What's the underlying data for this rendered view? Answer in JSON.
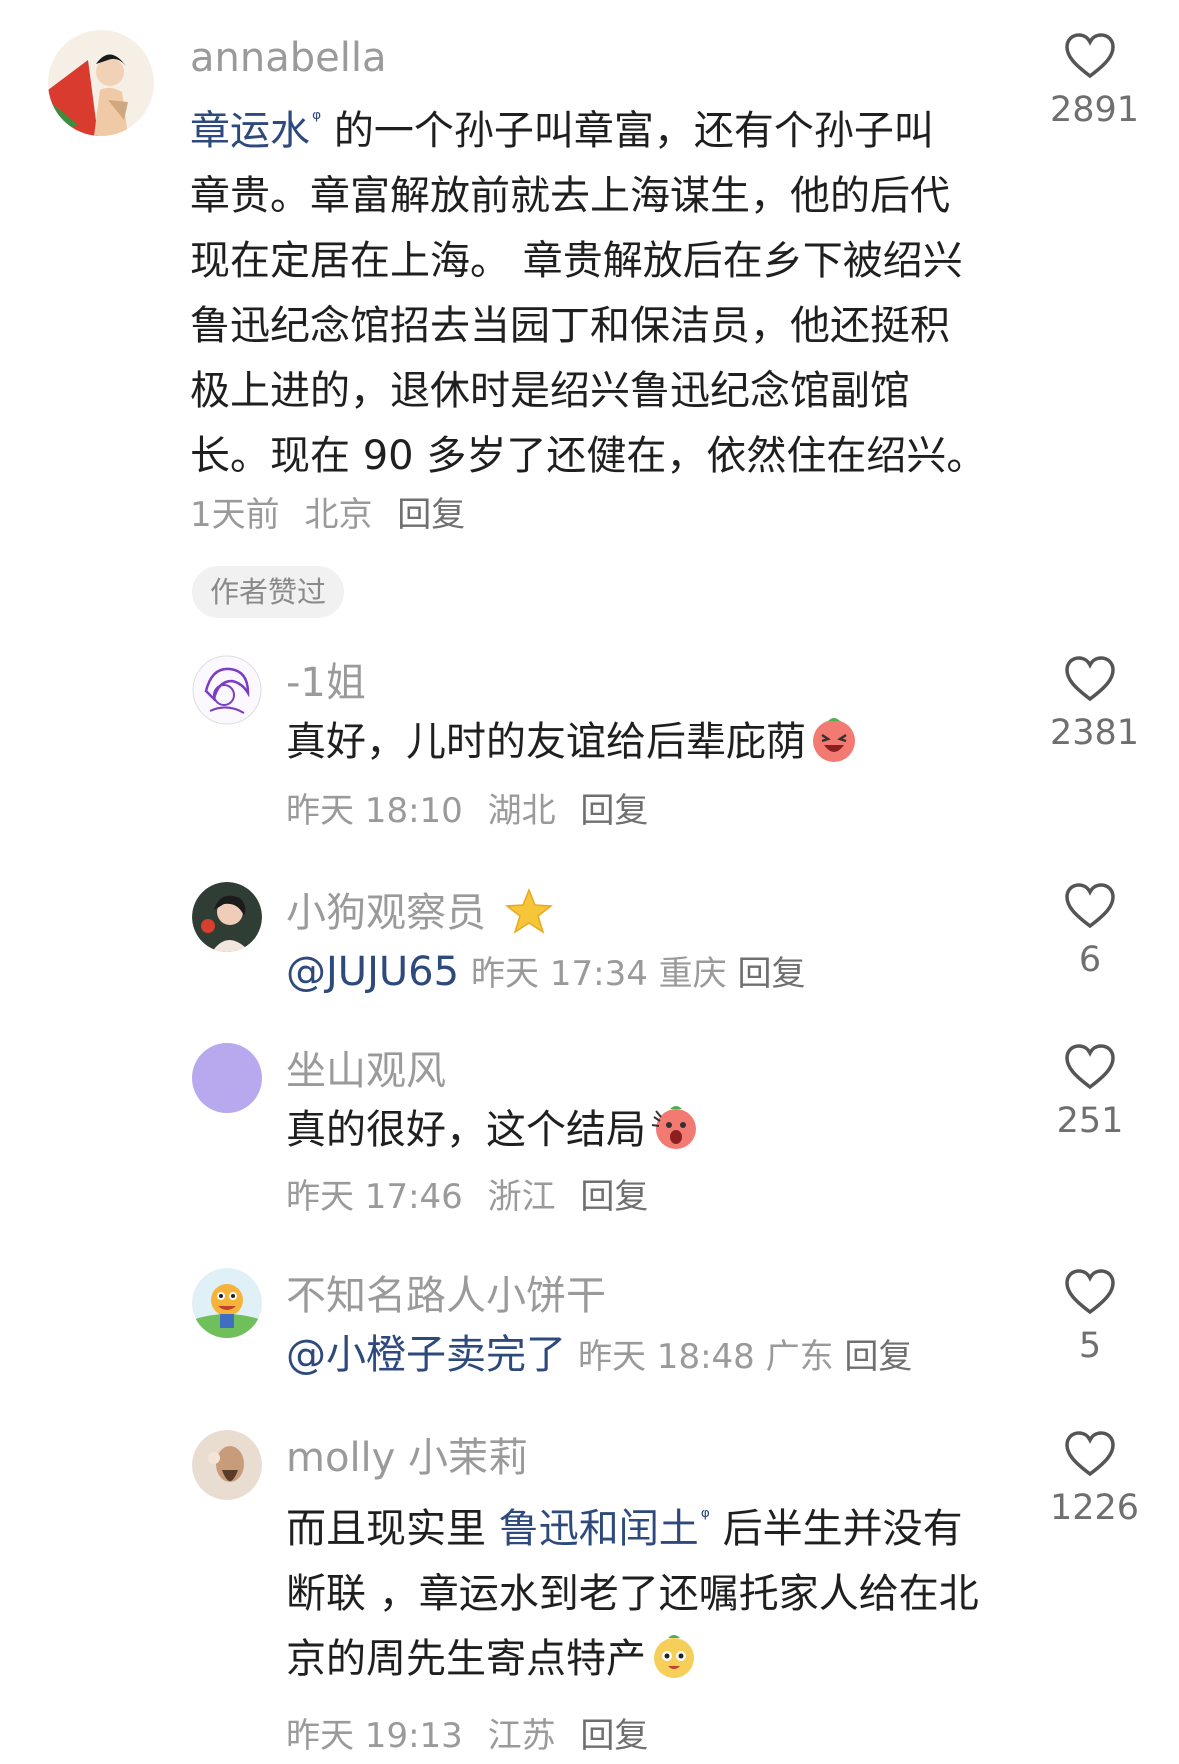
{
  "comments": [
    {
      "username": "annabella",
      "text_link": "章运水",
      "text_lines": [
        "的一个孙子叫章富，还有个孙子叫",
        "章贵。章富解放前就去上海谋生，他的后代",
        "现在定居在上海。 章贵解放后在乡下被绍兴",
        "鲁迅纪念馆招去当园丁和保洁员，他还挺积",
        "极上进的，退休时是绍兴鲁迅纪念馆副馆",
        "长。现在 90 多岁了还健在，依然住在绍兴。"
      ],
      "time": "1天前",
      "location": "北京",
      "reply": "回复",
      "badge": "作者赞过",
      "likes": "2891"
    },
    {
      "username": "-1姐",
      "text": "真好，儿时的友谊给后辈庇荫",
      "emoji": "laughing-emoji",
      "time": "昨天 18:10",
      "location": "湖北",
      "reply": "回复",
      "likes": "2381"
    },
    {
      "username": "小狗观察员",
      "username_icon": "star-icon",
      "mention": "@JUJU65",
      "time": "昨天 17:34",
      "location": "重庆",
      "reply": "回复",
      "likes": "6"
    },
    {
      "username": "坐山观风",
      "text": "真的很好，这个结局",
      "emoji": "shocked-emoji",
      "time": "昨天 17:46",
      "location": "浙江",
      "reply": "回复",
      "likes": "251"
    },
    {
      "username": "不知名路人小饼干",
      "mention": "@小橙子卖完了",
      "time": "昨天 18:48",
      "location": "广东",
      "reply": "回复",
      "likes": "5"
    },
    {
      "username": "molly 小茉莉",
      "text_prefix": "而且现实里",
      "text_link": "鲁迅和闰土",
      "text_suffix": "后半生并没有",
      "text_lines": [
        "断联 ，章运水到老了还嘱托家人给在北",
        "京的周先生寄点特产"
      ],
      "emoji": "smiling-emoji",
      "time": "昨天 19:13",
      "location": "江苏",
      "reply": "回复",
      "likes": "1226"
    }
  ],
  "colors": {
    "link": "#2e4a7d",
    "muted": "#9a9a9a",
    "badge_bg": "#f1f1f1",
    "lavender_avatar": "#b8a9ef"
  }
}
